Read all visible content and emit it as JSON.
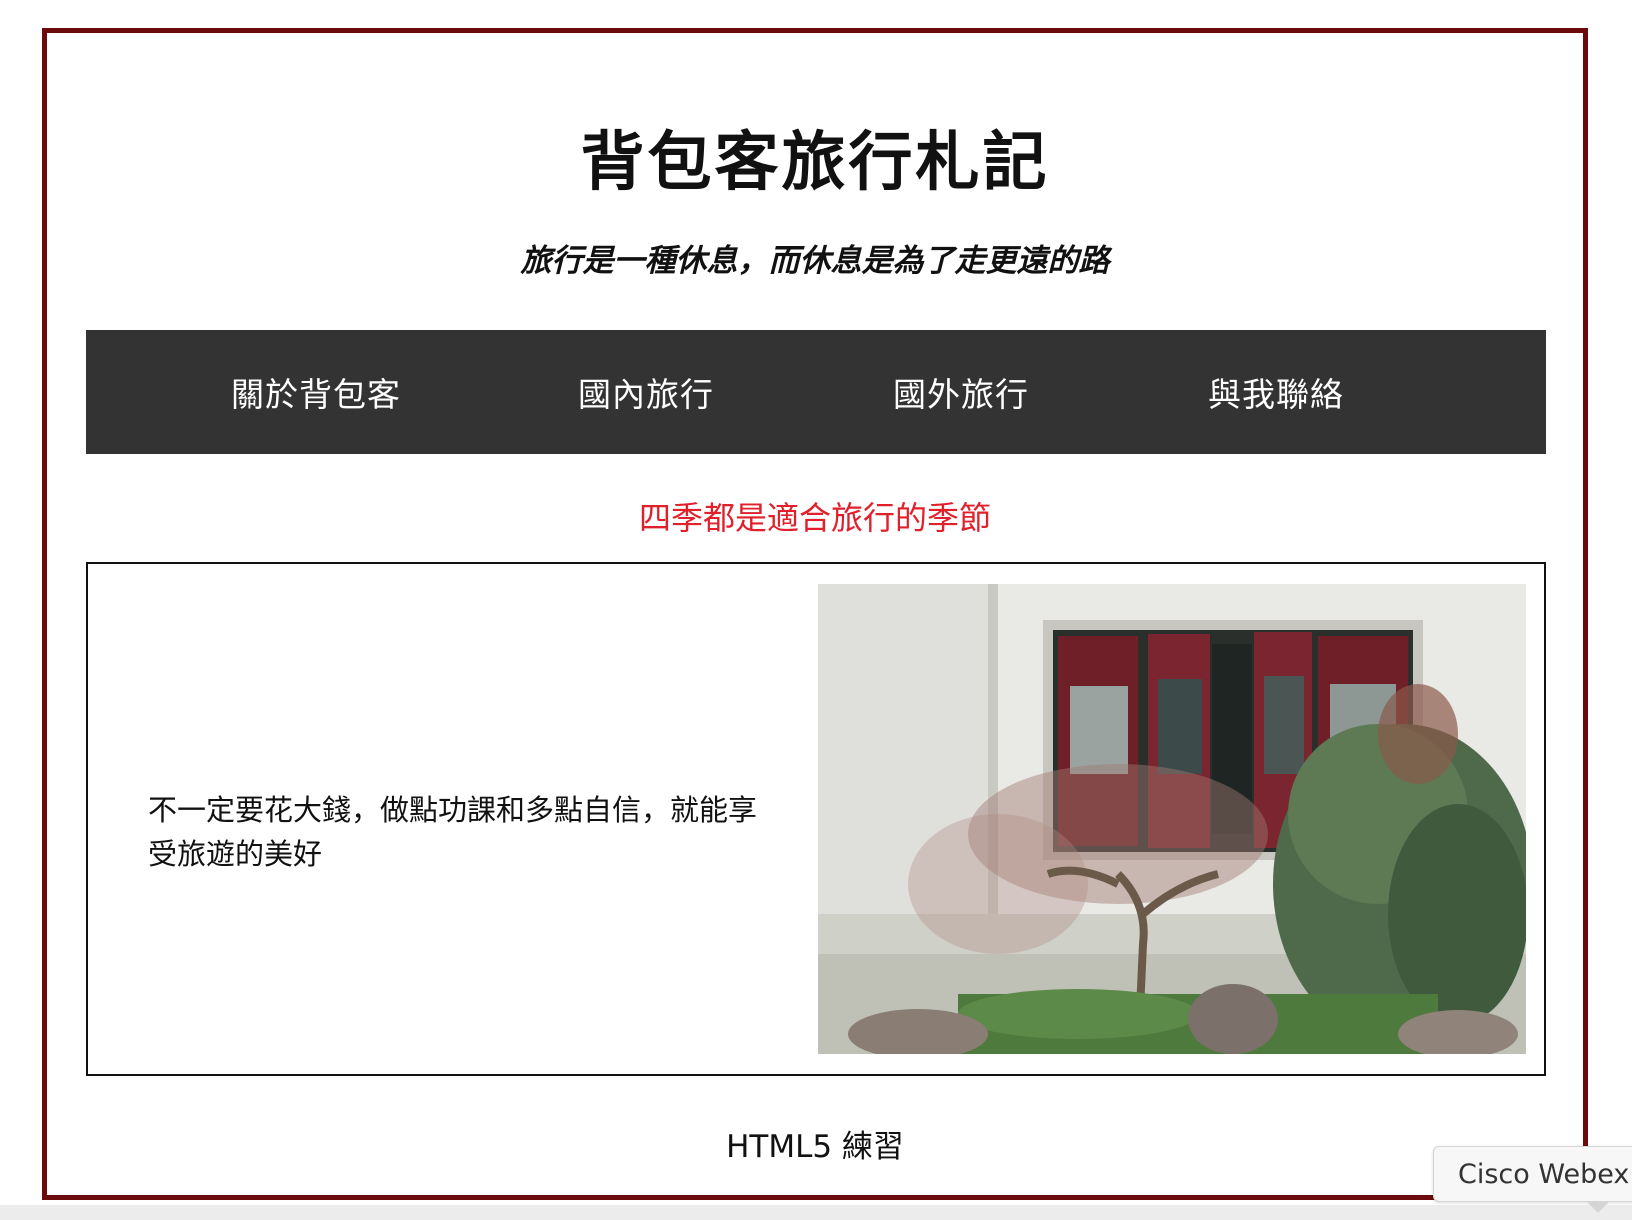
{
  "header": {
    "title": "背包客旅行札記",
    "tagline": "旅行是一種休息，而休息是為了走更遠的路"
  },
  "nav": {
    "items": [
      {
        "label": "關於背包客"
      },
      {
        "label": "國內旅行"
      },
      {
        "label": "國外旅行"
      },
      {
        "label": "與我聯絡"
      }
    ]
  },
  "section": {
    "heading": "四季都是適合旅行的季節",
    "text": "不一定要花大錢，做點功課和多點自信，就能享受旅遊的美好"
  },
  "footer": {
    "text": "HTML5 練習"
  },
  "tooltip": {
    "text": "Cisco Webex"
  },
  "colors": {
    "frame_border": "#6b0b0b",
    "nav_bg": "#333333",
    "heading_red": "#e0202a"
  }
}
